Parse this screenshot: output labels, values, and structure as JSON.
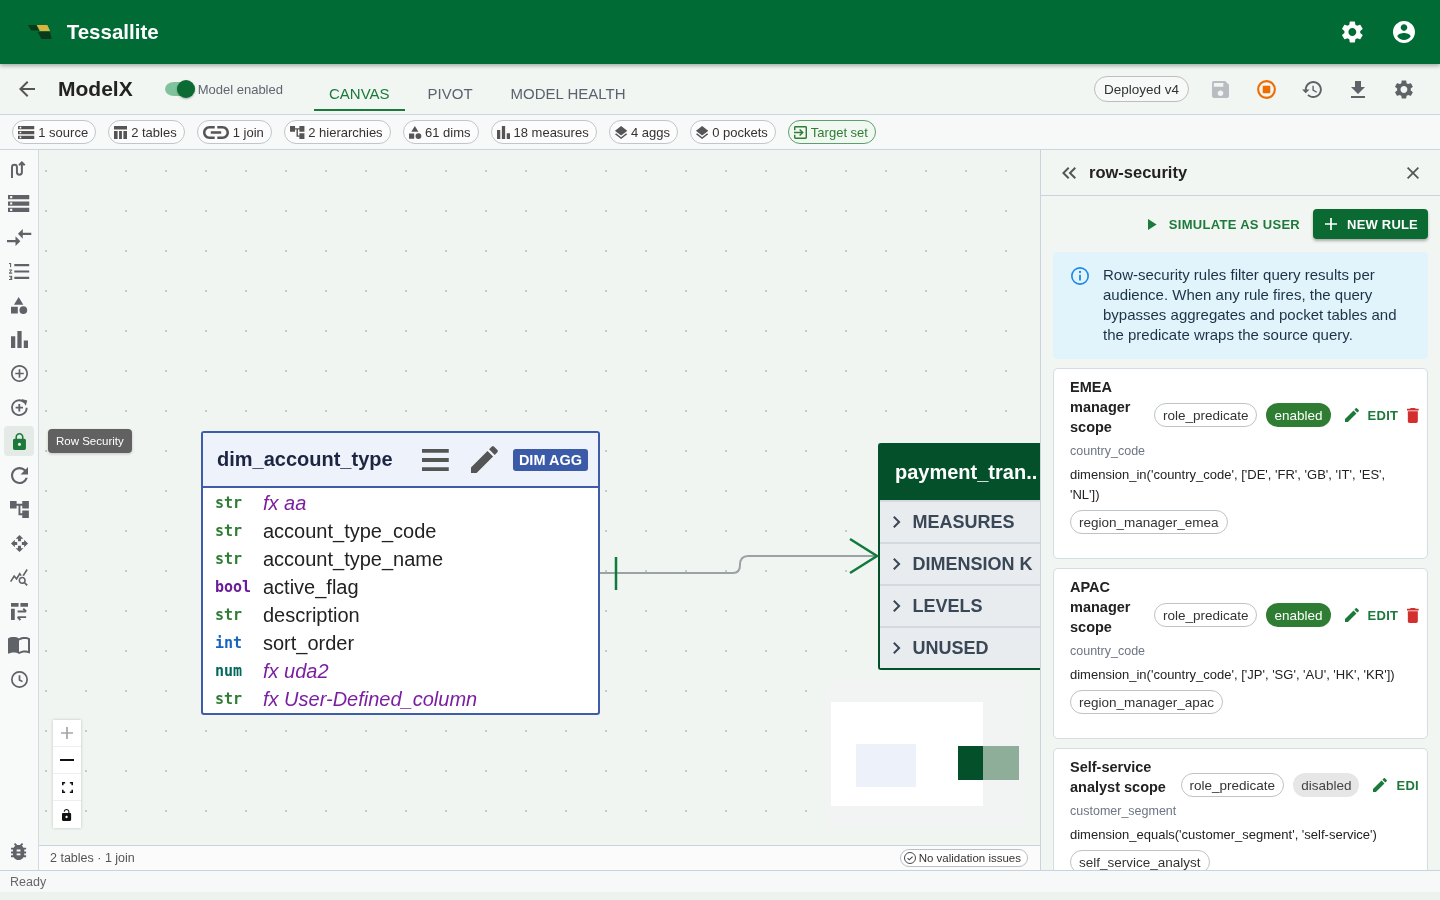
{
  "app_bar": {
    "title": "Tessallite"
  },
  "header": {
    "model_name": "ModelX",
    "model_toggle": {
      "label": "Model enabled",
      "on": true
    },
    "tabs": [
      {
        "label": "CANVAS",
        "selected": true
      },
      {
        "label": "PIVOT",
        "selected": false
      },
      {
        "label": "MODEL HEALTH",
        "selected": false
      }
    ],
    "deploy_status": "Deployed v4",
    "actions": [
      {
        "disabled": true
      },
      {
        "disabled": false
      },
      {
        "disabled": false
      },
      {
        "disabled": false
      },
      {
        "disabled": false
      }
    ]
  },
  "summary_chips": [
    {
      "kind": "count",
      "label": "1 source"
    },
    {
      "kind": "count",
      "label": "2 tables"
    },
    {
      "kind": "count",
      "label": "1 join"
    },
    {
      "kind": "count",
      "label": "2 hierarchies"
    },
    {
      "kind": "count",
      "label": "61 dims"
    },
    {
      "kind": "count",
      "label": "18 measures"
    },
    {
      "kind": "count",
      "label": "4 aggs"
    },
    {
      "kind": "count",
      "label": "0 pockets"
    },
    {
      "kind": "target",
      "label": "Target set"
    }
  ],
  "rail": {
    "items": [
      {
        "selected": false
      },
      {
        "selected": false
      },
      {
        "selected": false
      },
      {
        "selected": false
      },
      {
        "selected": false
      },
      {
        "selected": false
      },
      {
        "selected": false
      },
      {
        "selected": false
      },
      {
        "selected": true,
        "tooltip": "Row Security"
      },
      {
        "selected": false
      },
      {
        "selected": false
      },
      {
        "selected": false
      },
      {
        "selected": false
      },
      {
        "selected": false
      },
      {
        "selected": false
      },
      {
        "selected": false
      }
    ]
  },
  "canvas": {
    "nodes": [
      {
        "kind": "dimension",
        "title": "dim_account_type",
        "badge": "DIM AGG",
        "columns": [
          {
            "type": "str",
            "color": "#2e7d32",
            "name": "fx aa",
            "calculated": true
          },
          {
            "type": "str",
            "color": "#2e7d32",
            "name": "account_type_code",
            "calculated": false
          },
          {
            "type": "str",
            "color": "#2e7d32",
            "name": "account_type_name",
            "calculated": false
          },
          {
            "type": "bool",
            "color": "#6a1b9a",
            "name": "active_flag",
            "calculated": false
          },
          {
            "type": "str",
            "color": "#2e7d32",
            "name": "description",
            "calculated": false
          },
          {
            "type": "int",
            "color": "#1565c0",
            "name": "sort_order",
            "calculated": false
          },
          {
            "type": "num",
            "color": "#00695c",
            "name": "fx uda2",
            "calculated": true
          },
          {
            "type": "str",
            "color": "#2e7d32",
            "name": "fx User-Defined_column",
            "calculated": true
          }
        ]
      },
      {
        "kind": "fact",
        "title": "payment_tran..",
        "sections": [
          {
            "label": "MEASURES",
            "expanded": false
          },
          {
            "label": "DIMENSION K",
            "expanded": false
          },
          {
            "label": "LEVELS",
            "expanded": false
          },
          {
            "label": "UNUSED",
            "expanded": false
          }
        ]
      }
    ],
    "zoom_controls": [
      {
        "disabled": true
      },
      {
        "disabled": false
      },
      {
        "disabled": false
      },
      {
        "disabled": false
      }
    ],
    "footer": {
      "summary": "2 tables · 1 join",
      "validation": "No validation issues"
    }
  },
  "panel": {
    "title": "row-security",
    "simulate_label": "SIMULATE AS USER",
    "new_rule_label": "NEW RULE",
    "info": "Row-security rules filter query results per audience. When any rule fires, the query bypasses aggregates and pocket tables and the predicate wraps the source query.",
    "rules": [
      {
        "name": "EMEA manager scope",
        "type_chip": "role_predicate",
        "status": "enabled",
        "enabled": true,
        "edit_label": "EDIT",
        "delete_icon": true,
        "dimension": "country_code",
        "predicate": "dimension_in('country_code', ['DE', 'FR', 'GB', 'IT', 'ES', 'NL'])",
        "roles": [
          "region_manager_emea"
        ]
      },
      {
        "name": "APAC manager scope",
        "type_chip": "role_predicate",
        "status": "enabled",
        "enabled": true,
        "edit_label": "EDIT",
        "delete_icon": true,
        "dimension": "country_code",
        "predicate": "dimension_in('country_code', ['JP', 'SG', 'AU', 'HK', 'KR'])",
        "roles": [
          "region_manager_apac"
        ]
      },
      {
        "name": "Self-service analyst scope",
        "type_chip": "role_predicate",
        "status": "disabled",
        "enabled": false,
        "edit_label": "EDI",
        "delete_icon": false,
        "dimension": "customer_segment",
        "predicate": "dimension_equals('customer_segment', 'self-service')",
        "roles": [
          "self_service_analyst"
        ]
      }
    ]
  },
  "status_bar": {
    "text": "Ready"
  }
}
